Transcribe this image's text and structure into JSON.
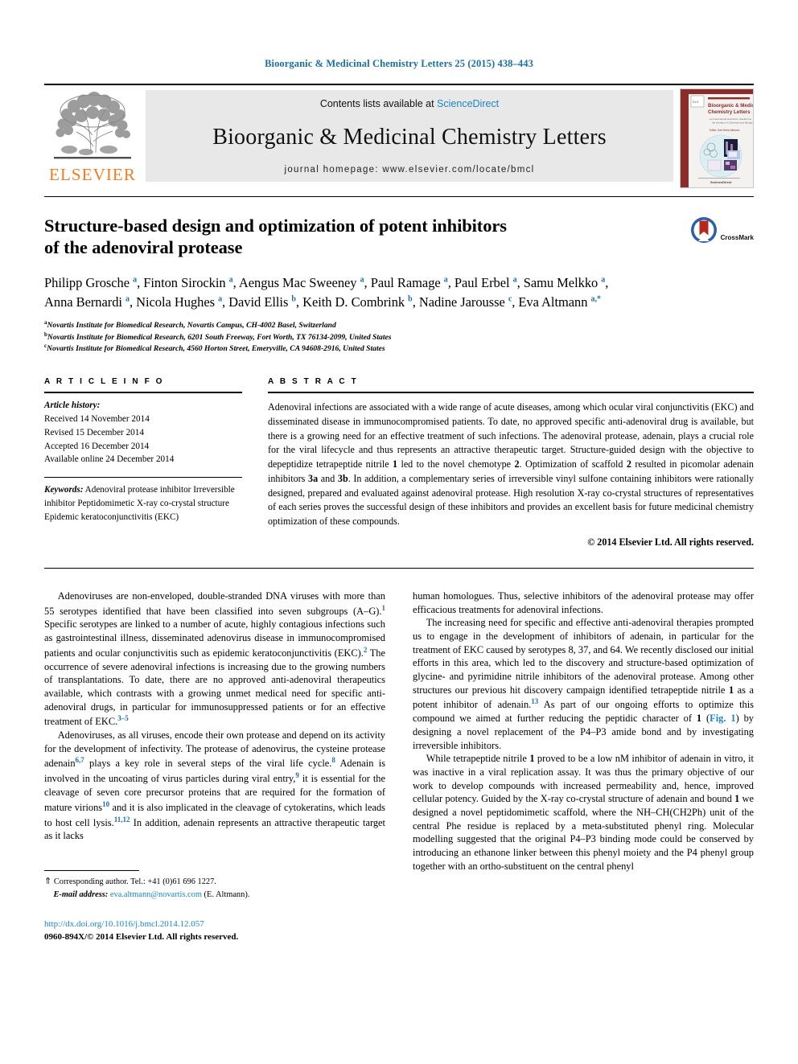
{
  "running_head": "Bioorganic & Medicinal Chemistry Letters 25 (2015) 438–443",
  "masthead": {
    "publisher_name": "ELSEVIER",
    "contents_prefix": "Contents lists available at ",
    "contents_link": "ScienceDirect",
    "journal_title": "Bioorganic & Medicinal Chemistry Letters",
    "homepage_line": "journal homepage: www.elsevier.com/locate/bmcl",
    "cover": {
      "title_line1": "Bioorganic & Medicinal",
      "title_line2": "Chemistry Letters",
      "subtitle": "An International Journal for research at the interface of Chemistry and Biology",
      "editors_line": "Editor: Karl-Heinz Altmann",
      "footer": "ScienceDirect"
    }
  },
  "article": {
    "title_line1": "Structure-based design and optimization of potent inhibitors",
    "title_line2": "of the adenoviral protease",
    "crossmark_label": "CrossMark",
    "authors_line1": "Philipp Grosche a, Finton Sirockin a, Aengus Mac Sweeney a, Paul Ramage a, Paul Erbel a, Samu Melkko a,",
    "authors_line2": "Anna Bernardi a, Nicola Hughes a, David Ellis b, Keith D. Combrink b, Nadine Jarousse c, Eva Altmann a,*",
    "affiliations": [
      {
        "mark": "a",
        "text": "Novartis Institute for Biomedical Research, Novartis Campus, CH-4002 Basel, Switzerland"
      },
      {
        "mark": "b",
        "text": "Novartis Institute for Biomedical Research, 6201 South Freeway, Fort Worth, TX 76134-2099, United States"
      },
      {
        "mark": "c",
        "text": "Novartis Institute for Biomedical Research, 4560 Horton Street, Emeryville, CA 94608-2916, United States"
      }
    ]
  },
  "article_info": {
    "heading": "A R T I C L E  I N F O",
    "history_label": "Article history:",
    "history": [
      "Received 14 November 2014",
      "Revised 15 December 2014",
      "Accepted 16 December 2014",
      "Available online 24 December 2014"
    ],
    "keywords_label": "Keywords:",
    "keywords": [
      "Adenoviral protease inhibitor",
      "Irreversible inhibitor",
      "Peptidomimetic",
      "X-ray co-crystal structure",
      "Epidemic keratoconjunctivitis (EKC)"
    ]
  },
  "abstract": {
    "heading": "A B S T R A C T",
    "text_parts": [
      {
        "t": "Adenoviral infections are associated with a wide range of acute diseases, among which ocular viral conjunctivitis (EKC) and disseminated disease in immunocompromised patients. To date, no approved specific anti-adenoviral drug is available, but there is a growing need for an effective treatment of such infections. The adenoviral protease, adenain, plays a crucial role for the viral lifecycle and thus represents an attractive therapeutic target. Structure-guided design with the objective to depeptidize tetrapeptide nitrile "
      },
      {
        "t": "1",
        "b": true
      },
      {
        "t": " led to the novel chemotype "
      },
      {
        "t": "2",
        "b": true
      },
      {
        "t": ". Optimization of scaffold "
      },
      {
        "t": "2",
        "b": true
      },
      {
        "t": " resulted in picomolar adenain inhibitors "
      },
      {
        "t": "3a",
        "b": true
      },
      {
        "t": " and "
      },
      {
        "t": "3b",
        "b": true
      },
      {
        "t": ". In addition, a complementary series of irreversible vinyl sulfone containing inhibitors were rationally designed, prepared and evaluated against adenoviral protease. High resolution X-ray co-crystal structures of representatives of each series proves the successful design of these inhibitors and provides an excellent basis for future medicinal chemistry optimization of these compounds."
      }
    ],
    "copyright": "© 2014 Elsevier Ltd. All rights reserved."
  },
  "body": {
    "left_column": [
      {
        "indent": true,
        "parts": [
          {
            "t": "Adenoviruses are non-enveloped, double-stranded DNA viruses with more than 55 serotypes identified that have been classified into seven subgroups (A–G)."
          },
          {
            "t": "1",
            "sup": true
          },
          {
            "t": " Specific serotypes are linked to a number of acute, highly contagious infections such as gastrointestinal illness, disseminated adenovirus disease in immunocompromised patients and ocular conjunctivitis such as epidemic keratoconjunctivitis (EKC)."
          },
          {
            "t": "2",
            "sup": true
          },
          {
            "t": " The occurrence of severe adenoviral infections is increasing due to the growing numbers of transplantations. To date, there are no approved anti-adenoviral therapeutics available, which contrasts with a growing unmet medical need for specific anti-adenoviral drugs, in particular for immunosuppressed patients or for an effective treatment of EKC."
          },
          {
            "t": "3–5",
            "sup": true
          }
        ]
      },
      {
        "indent": true,
        "parts": [
          {
            "t": "Adenoviruses, as all viruses, encode their own protease and depend on its activity for the development of infectivity. The protease of adenovirus, the cysteine protease adenain"
          },
          {
            "t": "6,7",
            "sup": true
          },
          {
            "t": " plays a key role in several steps of the viral life cycle."
          },
          {
            "t": "8",
            "sup": true
          },
          {
            "t": " Adenain is involved in the uncoating of virus particles during viral entry,"
          },
          {
            "t": "9",
            "sup": true
          },
          {
            "t": " it is essential for the cleavage of seven core precursor proteins that are required for the formation of mature virions"
          },
          {
            "t": "10",
            "sup": true
          },
          {
            "t": " and it is also implicated in the cleavage of cytokeratins, which leads to host cell lysis."
          },
          {
            "t": "11,12",
            "sup": true
          },
          {
            "t": " In addition, adenain represents an attractive therapeutic target as it lacks"
          }
        ]
      }
    ],
    "right_column": [
      {
        "indent": false,
        "parts": [
          {
            "t": "human homologues. Thus, selective inhibitors of the adenoviral protease may offer efficacious treatments for adenoviral infections."
          }
        ]
      },
      {
        "indent": true,
        "parts": [
          {
            "t": "The increasing need for specific and effective anti-adenoviral therapies prompted us to engage in the development of inhibitors of adenain, in particular for the treatment of EKC caused by serotypes 8, 37, and 64. We recently disclosed our initial efforts in this area, which led to the discovery and structure-based optimization of glycine- and pyrimidine nitrile inhibitors of the adenoviral protease. Among other structures our previous hit discovery campaign identified tetrapeptide nitrile "
          },
          {
            "t": "1",
            "b": true
          },
          {
            "t": " as a potent inhibitor of adenain."
          },
          {
            "t": "13",
            "sup": true
          },
          {
            "t": " As part of our ongoing efforts to optimize this compound we aimed at further reducing the peptidic character of "
          },
          {
            "t": "1",
            "b": true
          },
          {
            "t": " ("
          },
          {
            "t": "Fig. 1",
            "link": true
          },
          {
            "t": ") by designing a novel replacement of the P4–P3 amide bond and by investigating irreversible inhibitors."
          }
        ]
      },
      {
        "indent": true,
        "parts": [
          {
            "t": "While tetrapeptide nitrile "
          },
          {
            "t": "1",
            "b": true
          },
          {
            "t": " proved to be a low nM inhibitor of adenain in vitro, it was inactive in a viral replication assay. It was thus the primary objective of our work to develop compounds with increased permeability and, hence, improved cellular potency. Guided by the X-ray co-crystal structure of adenain and bound "
          },
          {
            "t": "1",
            "b": true
          },
          {
            "t": " we designed a novel peptidomimetic scaffold, where the NH–CH(CH2Ph) unit of the central Phe residue is replaced by a meta-substituted phenyl ring. Molecular modelling suggested that the original P4–P3 binding mode could be conserved by introducing an ethanone linker between this phenyl moiety and the P4 phenyl group together with an ortho-substituent on the central phenyl"
          }
        ]
      }
    ]
  },
  "footnotes": {
    "corresponding_star": "⇑",
    "corresponding_text": "Corresponding author. Tel.: +41 (0)61 696 1227.",
    "email_label": "E-mail address:",
    "email": "eva.altmann@novartis.com",
    "email_suffix": "(E. Altmann).",
    "doi": "http://dx.doi.org/10.1016/j.bmcl.2014.12.057",
    "issn_line": "0960-894X/© 2014 Elsevier Ltd. All rights reserved."
  },
  "colors": {
    "link_blue": "#1a86c8",
    "header_blue": "#1a6fa8",
    "elsevier_orange": "#ef7d23",
    "band_grey": "#e8e8e8",
    "cover_maroon": "#8c2c28"
  }
}
